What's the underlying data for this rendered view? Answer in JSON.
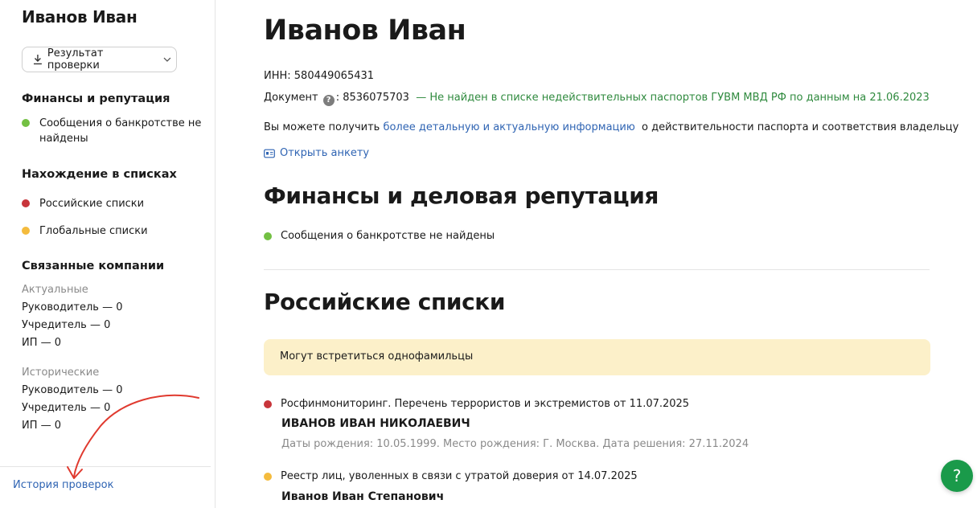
{
  "sidebar": {
    "title": "Иванов Иван",
    "result_button": "Результат проверки",
    "finance_heading": "Финансы и репутация",
    "bankruptcy_item": "Сообщения о банкротстве не найдены",
    "lists_heading": "Нахождение в списках",
    "lists": [
      {
        "label": "Российские списки",
        "status_color": "#c8353b"
      },
      {
        "label": "Глобальные списки",
        "status_color": "#f4bb3d"
      }
    ],
    "companies_heading": "Связанные компании",
    "actual_label": "Актуальные",
    "actual_rows": [
      "Руководитель — 0",
      "Учредитель — 0",
      "ИП — 0"
    ],
    "historical_label": "Исторические",
    "historical_rows": [
      "Руководитель — 0",
      "Учредитель — 0",
      "ИП — 0"
    ],
    "history_link": "История проверок"
  },
  "main": {
    "title": "Иванов Иван",
    "inn": "ИНН: 580449065431",
    "document_label": "Документ",
    "document_number": ": 8536075703",
    "document_status": "— Не найден в списке недействительных паспортов ГУВМ МВД РФ по данным на 21.06.2023",
    "info_prefix": "Вы можете получить",
    "info_link": "более детальную и актуальную информацию",
    "info_suffix": "о действительности паспорта и соответствия владельцу",
    "open_profile": "Открыть анкету",
    "finance_heading": "Финансы и деловая репутация",
    "bankruptcy_item": "Сообщения о банкротстве не найдены",
    "russian_lists_heading": "Российские списки",
    "warning": "Могут встретиться однофамильцы",
    "entries": [
      {
        "source": "Росфинмониторинг. Перечень террористов и экстремистов от 11.07.2025",
        "name": "ИВАНОВ ИВАН НИКОЛАЕВИЧ",
        "details": "Даты рождения: 10.05.1999. Место рождения: Г. Москва. Дата решения: 27.11.2024",
        "status_color": "#c8353b"
      },
      {
        "source": "Реестр лиц, уволенных в связи с утратой доверия от 14.07.2025",
        "name": "Иванов Иван Степанович",
        "status_color": "#f4bb3d"
      }
    ],
    "help_button": "?"
  },
  "colors": {
    "accent_link": "#2f64b3",
    "success": "#73c043",
    "danger": "#c8353b",
    "warning": "#f4bb3d",
    "help_button": "#1a9a4a"
  }
}
